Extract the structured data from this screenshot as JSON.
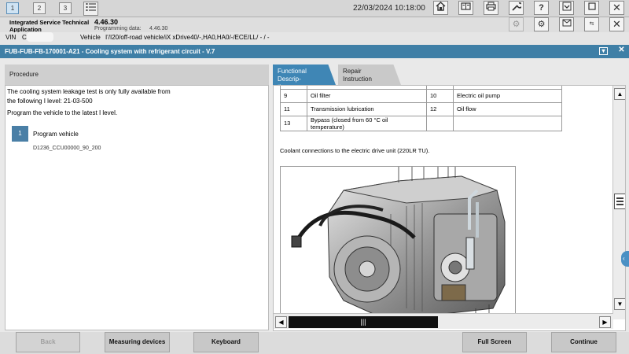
{
  "toolbar": {
    "tabs": [
      "1",
      "2",
      "3"
    ],
    "datetime": "22/03/2024 10:18:00",
    "icons": [
      "list-icon",
      "home-icon",
      "notebook-icon",
      "printer-icon",
      "wrench-icon",
      "help-icon",
      "minimize-icon",
      "maximize-icon",
      "close-icon"
    ]
  },
  "app": {
    "name_line1": "Integrated Service Technical",
    "name_line2": "Application",
    "version": "4.46.30",
    "programming_label": "Programming data:",
    "programming_value": "4.46.30",
    "vin_label": "VIN",
    "vin_value": "C",
    "vehicle_label": "Vehicle",
    "vehicle_value": "I'/I20/off-road vehicle/iX xDrive40/-,HA0,HA0/-/ECE/LL/ - / -"
  },
  "document": {
    "title": "FUB-FUB-FB-170001-A21 - Cooling system with refrigerant circuit - V.7"
  },
  "left": {
    "tab": "Procedure",
    "text1": "The cooling system leakage test is only fully available from",
    "text2": "the following I level: 21-03-500",
    "text3": "Program the vehicle to the latest I level.",
    "step_number": "1",
    "step_title": "Program vehicle",
    "step_code": "D1236_CCU00000_90_200"
  },
  "right": {
    "tab_functional_1": "Functional Descrip-",
    "tab_functional_2": "tion",
    "tab_repair_1": "Repair",
    "tab_repair_2": "Instruction",
    "table": [
      [
        "9",
        "Oil filter",
        "10",
        "Electric oil pump"
      ],
      [
        "11",
        "Transmission lubrication",
        "12",
        "Oil flow"
      ],
      [
        "13",
        "Bypass (closed from 60 °C oil temperature)",
        "",
        ""
      ]
    ],
    "caption": "Coolant connections to the electric drive unit (220LR TU)."
  },
  "bottom": {
    "back": "Back",
    "measuring": "Measuring devices",
    "keyboard": "Keyboard",
    "fullscreen": "Full Screen",
    "continue": "Continue"
  }
}
